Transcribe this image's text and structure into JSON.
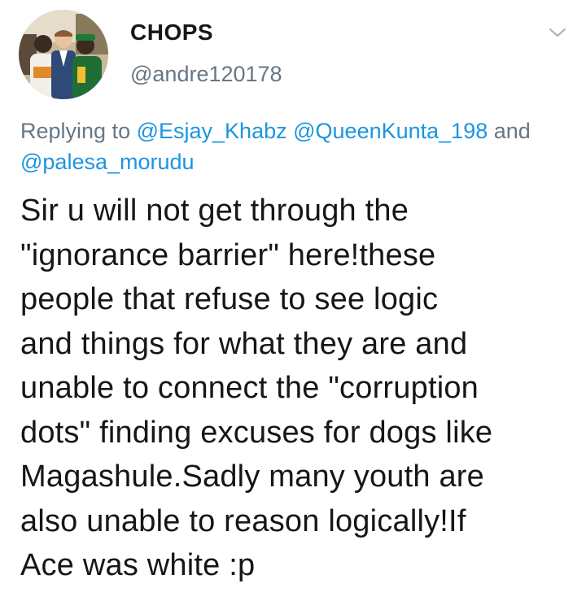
{
  "user": {
    "display_name": "CHOPS",
    "handle": "@andre120178",
    "avatar_icon": "profile-photo"
  },
  "menu": {
    "icon": "chevron-down-icon"
  },
  "reply_context": {
    "prefix": "Replying to ",
    "mentions": [
      "@Esjay_Khabz",
      "@QueenKunta_198",
      "@palesa_morudu"
    ],
    "conjunction": " and "
  },
  "tweet": {
    "lines": [
      "Sir u will not get through the",
      "\"ignorance barrier\" here!these",
      "people that refuse to see logic",
      "and things for what they are and",
      "unable to connect the \"corruption",
      "dots\" finding excuses for dogs like",
      "Magashule.Sadly many youth are",
      "also unable to reason logically!If",
      "Ace was white :p"
    ]
  },
  "colors": {
    "text": "#14171a",
    "secondary": "#657786",
    "link": "#1b95e0",
    "background": "#ffffff"
  }
}
